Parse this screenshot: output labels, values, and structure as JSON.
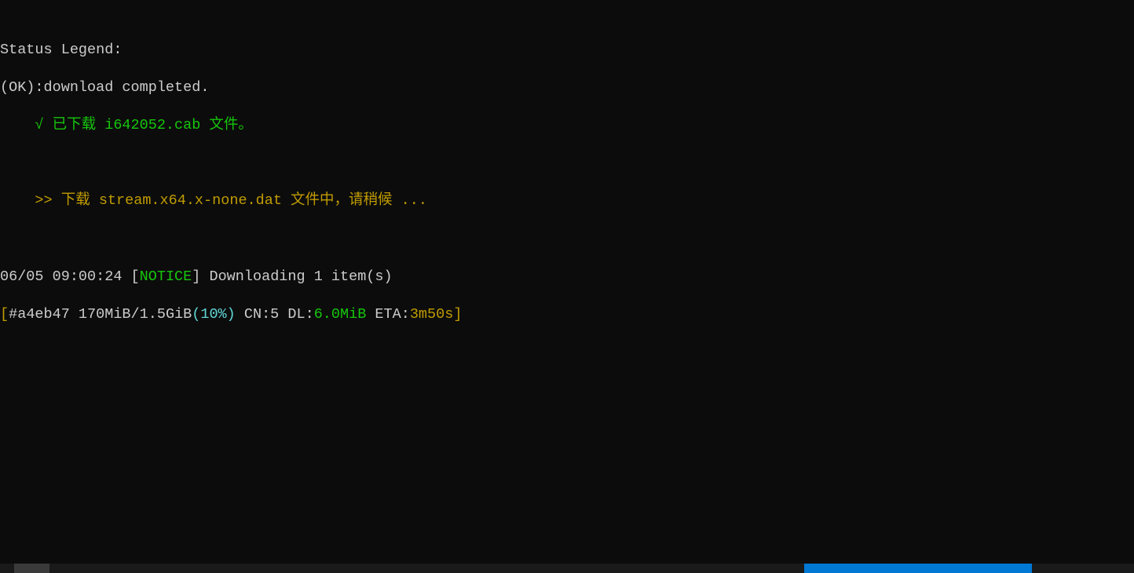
{
  "terminal": {
    "legend_header": "Status Legend:",
    "legend_ok": "(OK):download completed.",
    "downloaded_line": "    √ 已下载 i642052.cab 文件。",
    "downloading_line": "    >> 下载 stream.x64.x-none.dat 文件中，请稍候 ...",
    "notice": {
      "timestamp": "06/05 09:00:24 ",
      "bracket_open": "[",
      "notice_label": "NOTICE",
      "bracket_close": "]",
      "message": " Downloading 1 item(s)"
    },
    "progress": {
      "bracket_open": "[",
      "id_size": "#a4eb47 170MiB/1.5GiB",
      "percent": "(10%)",
      "cn_dl_prefix": " CN:5 DL:",
      "dl_speed": "6.0MiB",
      "eta_prefix": " ETA:",
      "eta_value": "3m50s",
      "bracket_close": "]"
    }
  }
}
